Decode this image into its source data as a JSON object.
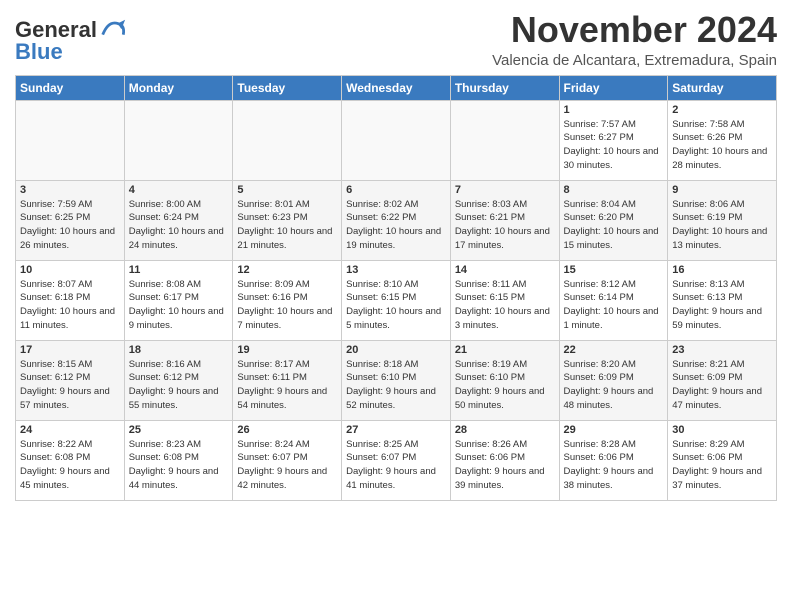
{
  "header": {
    "logo_line1": "General",
    "logo_line2": "Blue",
    "title": "November 2024",
    "subtitle": "Valencia de Alcantara, Extremadura, Spain"
  },
  "weekdays": [
    "Sunday",
    "Monday",
    "Tuesday",
    "Wednesday",
    "Thursday",
    "Friday",
    "Saturday"
  ],
  "weeks": [
    [
      {
        "day": "",
        "info": ""
      },
      {
        "day": "",
        "info": ""
      },
      {
        "day": "",
        "info": ""
      },
      {
        "day": "",
        "info": ""
      },
      {
        "day": "",
        "info": ""
      },
      {
        "day": "1",
        "info": "Sunrise: 7:57 AM\nSunset: 6:27 PM\nDaylight: 10 hours and 30 minutes."
      },
      {
        "day": "2",
        "info": "Sunrise: 7:58 AM\nSunset: 6:26 PM\nDaylight: 10 hours and 28 minutes."
      }
    ],
    [
      {
        "day": "3",
        "info": "Sunrise: 7:59 AM\nSunset: 6:25 PM\nDaylight: 10 hours and 26 minutes."
      },
      {
        "day": "4",
        "info": "Sunrise: 8:00 AM\nSunset: 6:24 PM\nDaylight: 10 hours and 24 minutes."
      },
      {
        "day": "5",
        "info": "Sunrise: 8:01 AM\nSunset: 6:23 PM\nDaylight: 10 hours and 21 minutes."
      },
      {
        "day": "6",
        "info": "Sunrise: 8:02 AM\nSunset: 6:22 PM\nDaylight: 10 hours and 19 minutes."
      },
      {
        "day": "7",
        "info": "Sunrise: 8:03 AM\nSunset: 6:21 PM\nDaylight: 10 hours and 17 minutes."
      },
      {
        "day": "8",
        "info": "Sunrise: 8:04 AM\nSunset: 6:20 PM\nDaylight: 10 hours and 15 minutes."
      },
      {
        "day": "9",
        "info": "Sunrise: 8:06 AM\nSunset: 6:19 PM\nDaylight: 10 hours and 13 minutes."
      }
    ],
    [
      {
        "day": "10",
        "info": "Sunrise: 8:07 AM\nSunset: 6:18 PM\nDaylight: 10 hours and 11 minutes."
      },
      {
        "day": "11",
        "info": "Sunrise: 8:08 AM\nSunset: 6:17 PM\nDaylight: 10 hours and 9 minutes."
      },
      {
        "day": "12",
        "info": "Sunrise: 8:09 AM\nSunset: 6:16 PM\nDaylight: 10 hours and 7 minutes."
      },
      {
        "day": "13",
        "info": "Sunrise: 8:10 AM\nSunset: 6:15 PM\nDaylight: 10 hours and 5 minutes."
      },
      {
        "day": "14",
        "info": "Sunrise: 8:11 AM\nSunset: 6:15 PM\nDaylight: 10 hours and 3 minutes."
      },
      {
        "day": "15",
        "info": "Sunrise: 8:12 AM\nSunset: 6:14 PM\nDaylight: 10 hours and 1 minute."
      },
      {
        "day": "16",
        "info": "Sunrise: 8:13 AM\nSunset: 6:13 PM\nDaylight: 9 hours and 59 minutes."
      }
    ],
    [
      {
        "day": "17",
        "info": "Sunrise: 8:15 AM\nSunset: 6:12 PM\nDaylight: 9 hours and 57 minutes."
      },
      {
        "day": "18",
        "info": "Sunrise: 8:16 AM\nSunset: 6:12 PM\nDaylight: 9 hours and 55 minutes."
      },
      {
        "day": "19",
        "info": "Sunrise: 8:17 AM\nSunset: 6:11 PM\nDaylight: 9 hours and 54 minutes."
      },
      {
        "day": "20",
        "info": "Sunrise: 8:18 AM\nSunset: 6:10 PM\nDaylight: 9 hours and 52 minutes."
      },
      {
        "day": "21",
        "info": "Sunrise: 8:19 AM\nSunset: 6:10 PM\nDaylight: 9 hours and 50 minutes."
      },
      {
        "day": "22",
        "info": "Sunrise: 8:20 AM\nSunset: 6:09 PM\nDaylight: 9 hours and 48 minutes."
      },
      {
        "day": "23",
        "info": "Sunrise: 8:21 AM\nSunset: 6:09 PM\nDaylight: 9 hours and 47 minutes."
      }
    ],
    [
      {
        "day": "24",
        "info": "Sunrise: 8:22 AM\nSunset: 6:08 PM\nDaylight: 9 hours and 45 minutes."
      },
      {
        "day": "25",
        "info": "Sunrise: 8:23 AM\nSunset: 6:08 PM\nDaylight: 9 hours and 44 minutes."
      },
      {
        "day": "26",
        "info": "Sunrise: 8:24 AM\nSunset: 6:07 PM\nDaylight: 9 hours and 42 minutes."
      },
      {
        "day": "27",
        "info": "Sunrise: 8:25 AM\nSunset: 6:07 PM\nDaylight: 9 hours and 41 minutes."
      },
      {
        "day": "28",
        "info": "Sunrise: 8:26 AM\nSunset: 6:06 PM\nDaylight: 9 hours and 39 minutes."
      },
      {
        "day": "29",
        "info": "Sunrise: 8:28 AM\nSunset: 6:06 PM\nDaylight: 9 hours and 38 minutes."
      },
      {
        "day": "30",
        "info": "Sunrise: 8:29 AM\nSunset: 6:06 PM\nDaylight: 9 hours and 37 minutes."
      }
    ]
  ]
}
